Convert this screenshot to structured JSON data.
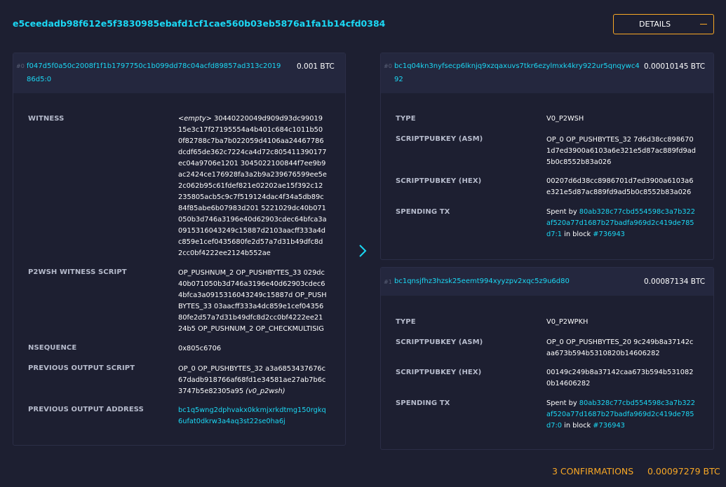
{
  "tx": {
    "txid": "e5ceedadb98f612e5f3830985ebafd1cf1cae560b03eb5876a1fa1b14cfd0384",
    "details_label": "DETAILS"
  },
  "input": {
    "index": "#0",
    "prev_txid": "f047d5f0a50c2008f1f1b1797750c1b099dd78c04acfd89857ad313c2019",
    "prev_txid_cont": "86d5:0",
    "amount": "0.001 BTC",
    "witness_label": "WITNESS",
    "witness_empty": "<empty>",
    "witness_value": "30440220049d909d93dc9901915e3c17f27195554a4b401c684c1011b500f82788c7ba7b022059d4106aa24467786dcdf65de362c7224ca4d72c805411390177ec04a9706e1201 3045022100844f7ee9b9ac2424ce176928fa3a2b9a239676599ee5e2c062b95c61fdef821e02202ae15f392c12235805acb5c9c7f519124dac4f34a5db89c84f85abe6b07983d201 5221029dc40b071050b3d746a3196e40d62903cdec64bfca3a0915316043249c15887d2103aacff333a4dc859e1cef0435680fe2d57a7d31b49dfc8d2cc0bf4222ee2124b552ae",
    "witness_script_label": "P2WSH WITNESS SCRIPT",
    "witness_script_value": "OP_PUSHNUM_2 OP_PUSHBYTES_33 029dc40b071050b3d746a3196e40d62903cdec64bfca3a0915316043249c15887d OP_PUSHBYTES_33 03aacff333a4dc859e1cef0435680fe2d57a7d31b49dfc8d2cc0bf4222ee2124b5 OP_PUSHNUM_2 OP_CHECKMULTISIG",
    "nsequence_label": "NSEQUENCE",
    "nsequence_value": "0x805c6706",
    "prev_script_label": "PREVIOUS OUTPUT SCRIPT",
    "prev_script_value": "OP_0 OP_PUSHBYTES_32 a3a6853437676c67dadb918766af68fd1e34581ae27ab7b6c3747b5e82305a95",
    "prev_script_type": "(v0_p2wsh)",
    "prev_address_label": "PREVIOUS OUTPUT ADDRESS",
    "prev_address_value": "bc1q5wng2dphvakx0kkmjxrkdtmg150rgkq6ufat0dkrw3a4aq3st22se0ha6j"
  },
  "outputs": [
    {
      "index": "#0",
      "address": "bc1q04kn3nyfsecp6lknjq9xzqaxuvs7tkr6ezylmxk4kry922ur5qnqywc4",
      "address_cont": "92",
      "amount": "0.00010145 BTC",
      "type_label": "TYPE",
      "type_value": "V0_P2WSH",
      "asm_label": "SCRIPTPUBKEY (ASM)",
      "asm_value": "OP_0 OP_PUSHBYTES_32 7d6d38cc8986701d7ed3900a6103a6e321e5d87ac889fd9ad5b0c8552b83a026",
      "hex_label": "SCRIPTPUBKEY (HEX)",
      "hex_value": "00207d6d38cc8986701d7ed3900a6103a6e321e5d87ac889fd9ad5b0c8552b83a026",
      "spending_label": "SPENDING TX",
      "spent_by": "Spent by",
      "spent_txid": "80ab328c77cbd554598c3a7b322af520a77d1687b27badfa969d2c419de785d7:1",
      "in_block": "in block",
      "block": "#736943"
    },
    {
      "index": "#1",
      "address": "bc1qnsjfhz3hzsk25eemt994xyyzpv2xqc5z9u6d80",
      "amount": "0.00087134 BTC",
      "type_label": "TYPE",
      "type_value": "V0_P2WPKH",
      "asm_label": "SCRIPTPUBKEY (ASM)",
      "asm_value": "OP_0 OP_PUSHBYTES_20 9c249b8a37142caa673b594b5310820b14606282",
      "hex_label": "SCRIPTPUBKEY (HEX)",
      "hex_value": "00149c249b8a37142caa673b594b5310820b14606282",
      "spending_label": "SPENDING TX",
      "spent_by": "Spent by",
      "spent_txid": "80ab328c77cbd554598c3a7b322af520a77d1687b27badfa969d2c419de785d7:0",
      "in_block": "in block",
      "block": "#736943"
    }
  ],
  "footer": {
    "confirmations": "3 CONFIRMATIONS",
    "total": "0.00097279 BTC"
  },
  "colors": {
    "background": "#1d1f31",
    "panel_header": "#24273e",
    "link": "#1bd8f4",
    "accent": "#f9a825"
  },
  "icons": {
    "details_toggle": "minus-icon",
    "flow": "chevron-right-icon"
  }
}
